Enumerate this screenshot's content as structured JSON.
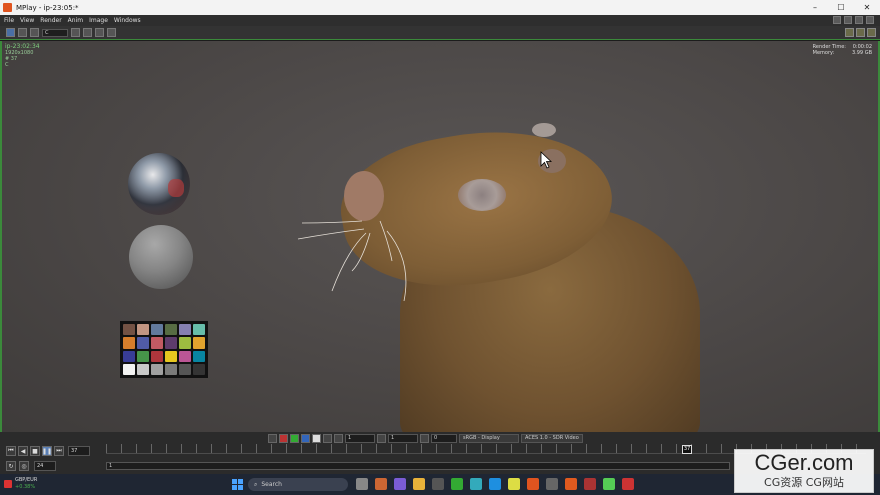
{
  "window": {
    "title": "MPlay - ip-23:05:*",
    "controls": [
      "–",
      "☐",
      "✕"
    ]
  },
  "menu": [
    "File",
    "View",
    "Render",
    "Anim",
    "Image",
    "Windows"
  ],
  "toolbar": {
    "channel_field": "C"
  },
  "viewport": {
    "info_left": {
      "name": "ip-23:02:34",
      "res": "1920x1080",
      "frame": "# 37",
      "channel": "C"
    },
    "info_right": {
      "render_time_label": "Render Time:",
      "render_time_value": "0:00:02",
      "memory_label": "Memory:",
      "memory_value": "3.99 GB"
    }
  },
  "checker_colors": [
    "#735244",
    "#c29682",
    "#627a9d",
    "#576c43",
    "#8580b1",
    "#67bdaa",
    "#d67e2c",
    "#505ba6",
    "#c15a63",
    "#5e3c6c",
    "#9dbc40",
    "#e0a32e",
    "#383d96",
    "#469449",
    "#af363c",
    "#e7c71f",
    "#bb5695",
    "#0885a1",
    "#f3f3f2",
    "#c8c8c8",
    "#a0a0a0",
    "#7a7a79",
    "#555555",
    "#343434"
  ],
  "view_controls": {
    "gamma": "1",
    "exposure": "1",
    "offset": "0",
    "display": "sRGB - Display",
    "view": "ACES 1.0 - SDR Video"
  },
  "timeline": {
    "current_frame": "37",
    "marker_frame": "37",
    "fps": "24",
    "range_start": "1"
  },
  "taskbar": {
    "ticker": "GBP/EUR",
    "change": "+0.38%",
    "search_placeholder": "Search"
  },
  "watermark": {
    "big": "CGer.com",
    "small": "CG资源 CG网站"
  }
}
